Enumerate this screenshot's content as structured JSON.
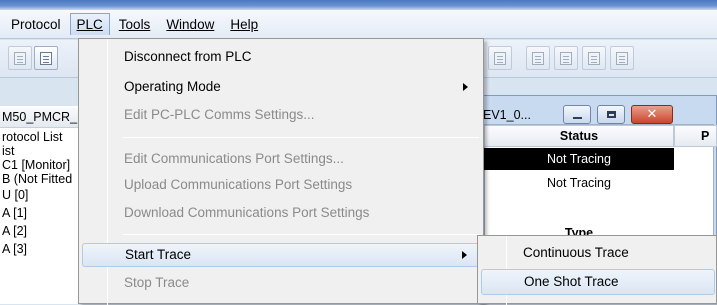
{
  "menubar": {
    "items": [
      "Protocol",
      "PLC",
      "Tools",
      "Window",
      "Help"
    ]
  },
  "tree": {
    "header": "M50_PMCR_",
    "items": [
      "rotocol List",
      "ist",
      "C1 [Monitor]",
      "B (Not Fitted",
      "U [0]",
      "A [1]",
      "A [2]",
      "A [3]"
    ]
  },
  "child_window": {
    "title": "EV1_0...",
    "columns": {
      "status": "Status",
      "p": "P"
    },
    "rows": [
      "Not Tracing",
      "Not Tracing"
    ],
    "type_header": "Type"
  },
  "plc_menu": {
    "items": [
      {
        "label": "Disconnect from PLC",
        "enabled": true,
        "submenu": false
      },
      {
        "label": "Operating Mode",
        "enabled": true,
        "submenu": true
      },
      {
        "label": "Edit PC-PLC Comms Settings...",
        "enabled": false,
        "submenu": false
      },
      {
        "label": "Edit Communications Port Settings...",
        "enabled": false,
        "submenu": false
      },
      {
        "label": "Upload Communications Port Settings",
        "enabled": false,
        "submenu": false
      },
      {
        "label": "Download Communications Port Settings",
        "enabled": false,
        "submenu": false
      },
      {
        "label": "Start Trace",
        "enabled": true,
        "submenu": true,
        "highlighted": true
      },
      {
        "label": "Stop Trace",
        "enabled": false,
        "submenu": false
      }
    ]
  },
  "trace_submenu": {
    "items": [
      "Continuous Trace",
      "One Shot Trace"
    ],
    "highlighted": "One Shot Trace"
  }
}
